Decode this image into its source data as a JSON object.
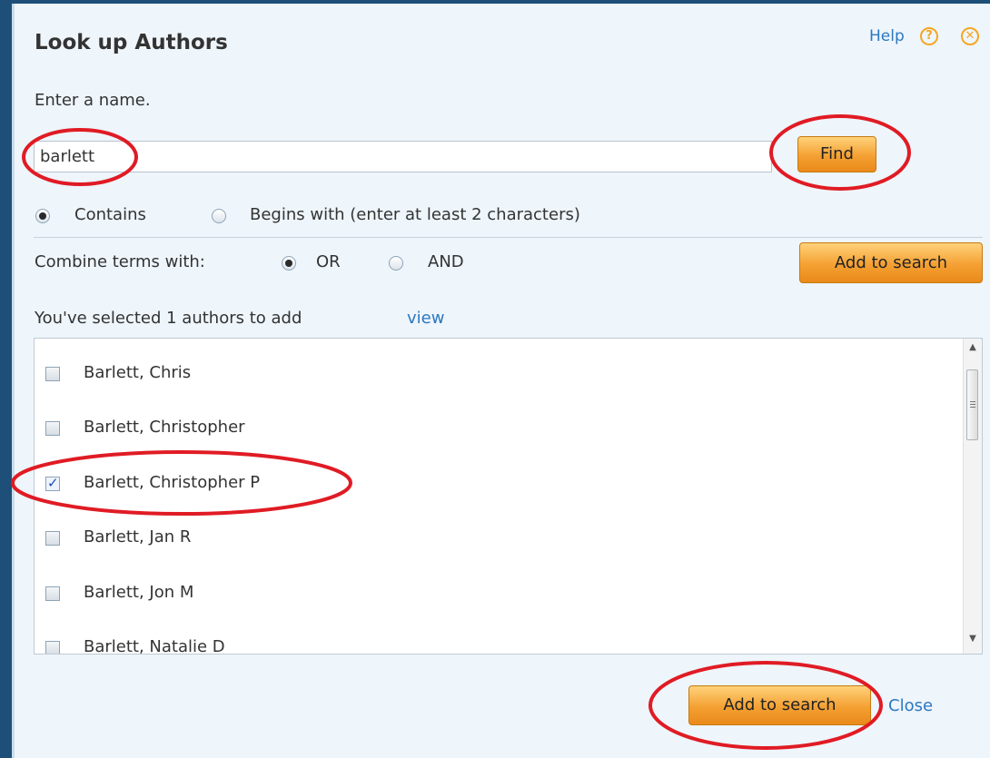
{
  "dialog": {
    "title": "Look up Authors",
    "help_label": "Help",
    "help_icon": "question-circle-icon",
    "close_icon": "close-circle-icon",
    "accent_color": "#f5a623",
    "link_color": "#2b78c2"
  },
  "search": {
    "prompt": "Enter a name.",
    "value": "barlett",
    "find_label": "Find"
  },
  "match_mode": {
    "contains_label": "Contains",
    "begins_label": "Begins with (enter at least 2 characters)",
    "selected": "Contains"
  },
  "combine": {
    "label": "Combine terms with:",
    "or_label": "OR",
    "and_label": "AND",
    "selected": "OR",
    "add_label": "Add to search"
  },
  "selection": {
    "text": "You've selected 1 authors to add",
    "view_label": "view"
  },
  "authors": [
    {
      "name": "Barlett, Chris",
      "checked": false
    },
    {
      "name": "Barlett, Christopher",
      "checked": false
    },
    {
      "name": "Barlett, Christopher P",
      "checked": true
    },
    {
      "name": "Barlett, Jan R",
      "checked": false
    },
    {
      "name": "Barlett, Jon M",
      "checked": false
    },
    {
      "name": "Barlett, Natalie D",
      "checked": false
    }
  ],
  "footer": {
    "add_label": "Add to search",
    "close_label": "Close"
  }
}
